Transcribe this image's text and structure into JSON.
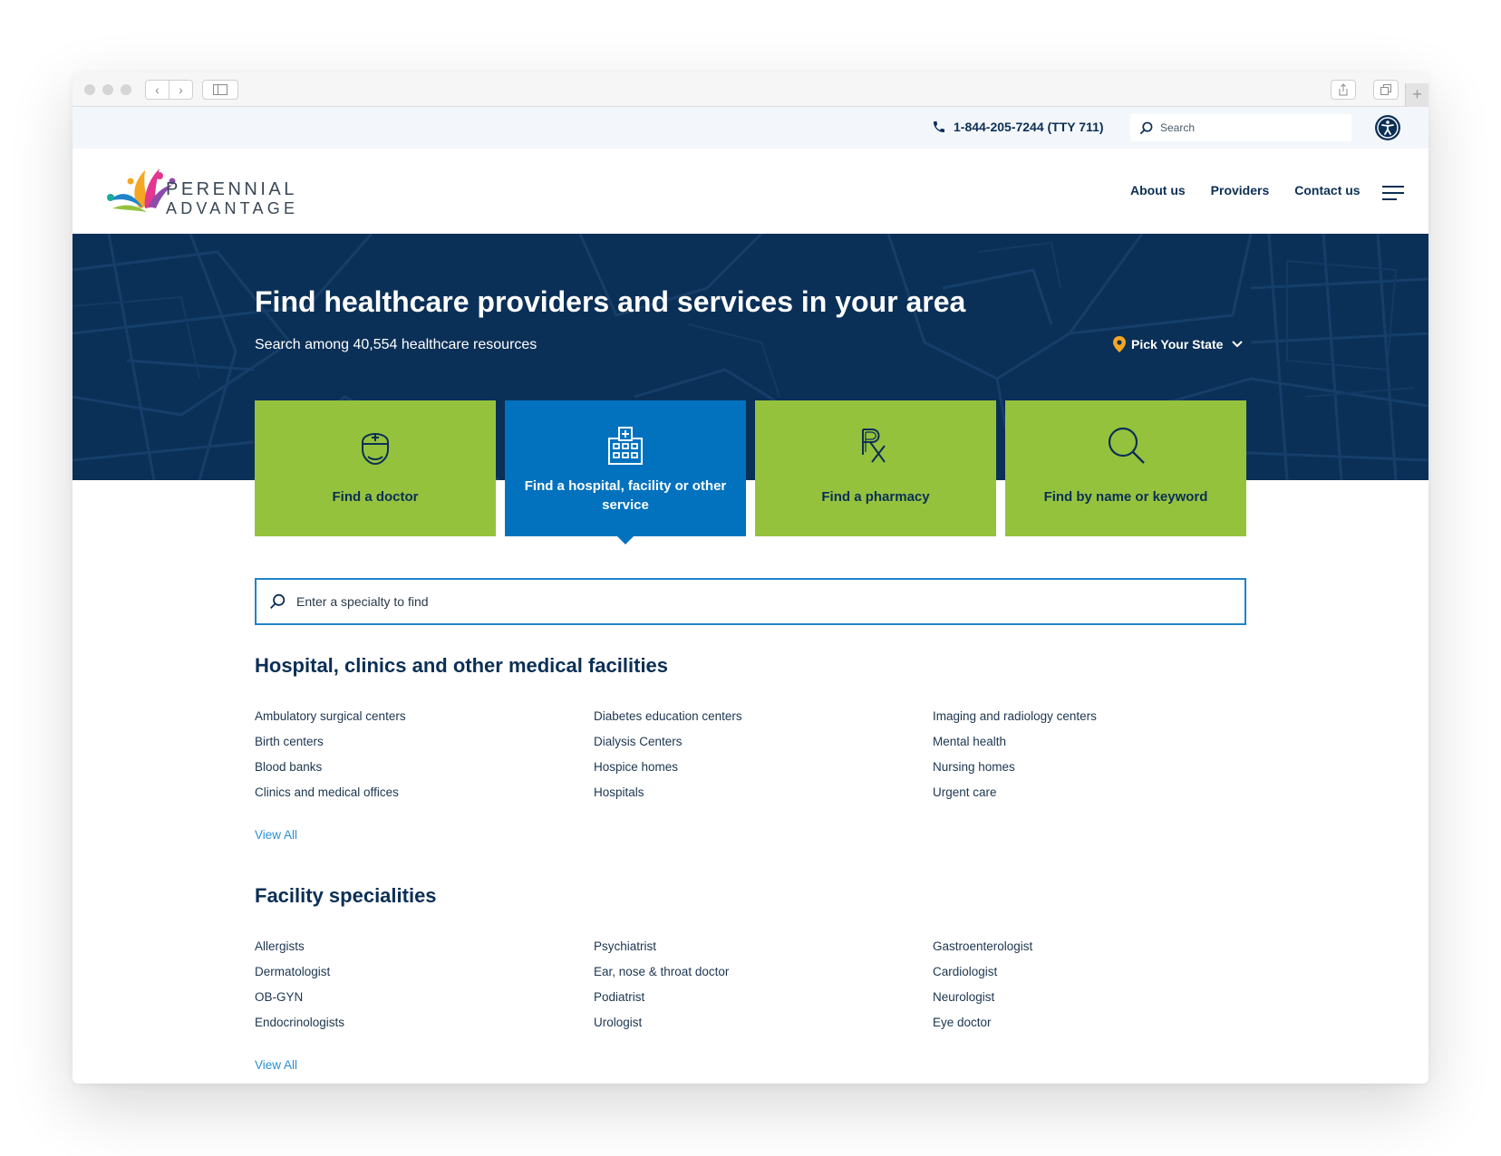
{
  "utility": {
    "phone": "1-844-205-7244 (TTY 711)",
    "search_placeholder": "Search"
  },
  "brand": {
    "line1": "PERENNIAL",
    "line2": "ADVANTAGE"
  },
  "nav": {
    "items": [
      "About us",
      "Providers",
      "Contact us"
    ]
  },
  "hero": {
    "title": "Find healthcare providers and services in your area",
    "subtitle": "Search among 40,554 healthcare resources",
    "state_picker": "Pick Your State"
  },
  "tiles": [
    {
      "label": "Find a doctor",
      "icon": "doctor-icon"
    },
    {
      "label": "Find a hospital, facility or other service",
      "icon": "hospital-icon",
      "active": true
    },
    {
      "label": "Find a pharmacy",
      "icon": "rx-icon"
    },
    {
      "label": "Find by name or keyword",
      "icon": "magnifier-icon"
    }
  ],
  "specialty_search": {
    "placeholder": "Enter a specialty to find"
  },
  "facilities": {
    "title": "Hospital, clinics and other medical facilities",
    "items": [
      "Ambulatory surgical centers",
      "Diabetes education centers",
      "Imaging and radiology centers",
      "Birth centers",
      "Dialysis Centers",
      "Mental health",
      "Blood banks",
      "Hospice homes",
      "Nursing homes",
      "Clinics and medical offices",
      "Hospitals",
      "Urgent care"
    ],
    "view_all": "View All"
  },
  "specialities": {
    "title": "Facility specialities",
    "items": [
      "Allergists",
      "Psychiatrist",
      "Gastroenterologist",
      "Dermatologist",
      "Ear, nose & throat doctor",
      "Cardiologist",
      "OB-GYN",
      "Podiatrist",
      "Neurologist",
      "Endocrinologists",
      "Urologist",
      "Eye doctor"
    ],
    "view_all": "View All"
  },
  "colors": {
    "navy": "#0b3057",
    "tile_green": "#95c23d",
    "tile_active_blue": "#0272bf",
    "link_blue": "#2a8fd6",
    "pin_orange": "#f5a623"
  }
}
